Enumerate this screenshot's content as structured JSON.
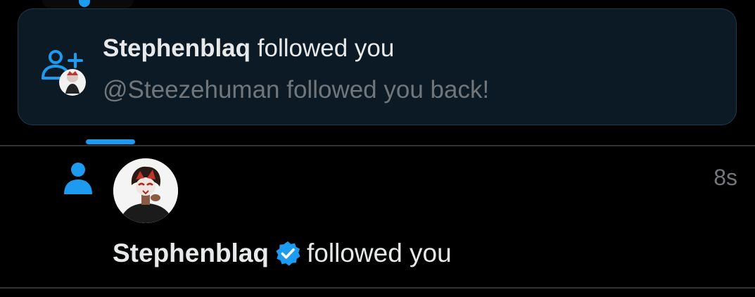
{
  "toast": {
    "name": "Stephenblaq",
    "action": "followed you",
    "subtitle": "@Steezehuman followed you back!"
  },
  "notification": {
    "time": "8s",
    "name": "Stephenblaq",
    "action": "followed you",
    "verified": true
  },
  "colors": {
    "accent": "#1d9bf0",
    "background": "#000000",
    "toast_background": "#0b1a24",
    "muted_text": "#71767b"
  },
  "icons": {
    "toast": "person-add-icon",
    "row": "person-icon",
    "badge": "verified-badge-icon"
  }
}
